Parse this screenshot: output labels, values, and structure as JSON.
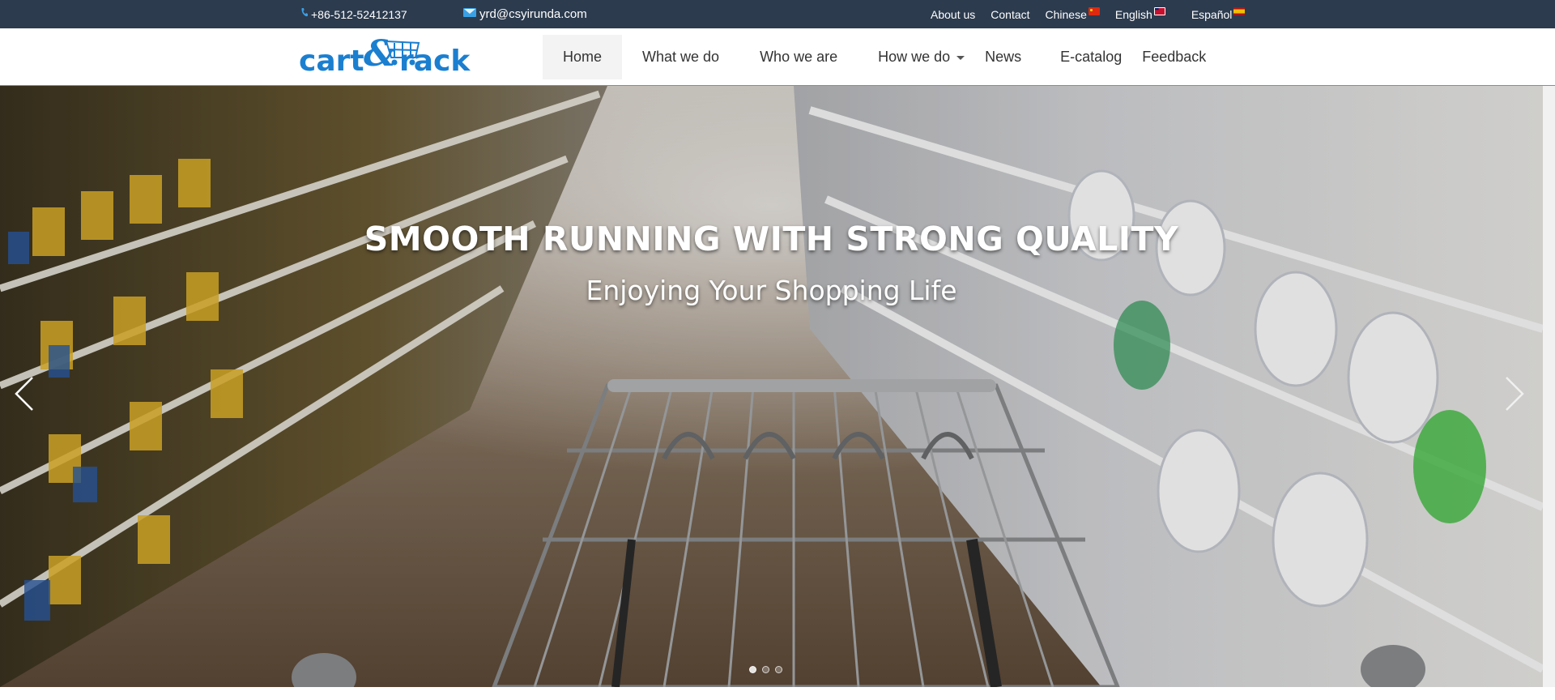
{
  "topbar": {
    "phone": "+86-512-52412137",
    "email": "yrd@csyirunda.com",
    "links": [
      {
        "label": "About us"
      },
      {
        "label": "Contact"
      },
      {
        "label": "Chinese",
        "flag": "cn-flag-icon"
      },
      {
        "label": "English",
        "flag": "uk-flag-icon"
      },
      {
        "label": "Español",
        "flag": "es-flag-icon"
      }
    ],
    "icons": {
      "phone": "phone-icon",
      "email": "email-icon"
    }
  },
  "logo": {
    "left_text": "cart",
    "ampersand": "&",
    "right_text": "rack"
  },
  "nav": {
    "items": [
      {
        "label": "Home",
        "active": true
      },
      {
        "label": "What we do"
      },
      {
        "label": "Who we are"
      },
      {
        "label": "How we do",
        "dropdown": true
      },
      {
        "label": "News"
      },
      {
        "label": "E-catalog"
      },
      {
        "label": "Feedback"
      }
    ]
  },
  "hero": {
    "title": "SMOOTH RUNNING WITH STRONG QUALITY",
    "subtitle": "Enjoying  Your Shopping Life",
    "slides_total": 3,
    "active_slide": 1,
    "icons": {
      "prev": "chevron-left-icon",
      "next": "chevron-right-icon"
    }
  },
  "colors": {
    "topbar_bg": "#2c3b4e",
    "logo_blue": "#1b7fd0",
    "nav_text": "#333333",
    "header_border": "#38a7d6"
  }
}
